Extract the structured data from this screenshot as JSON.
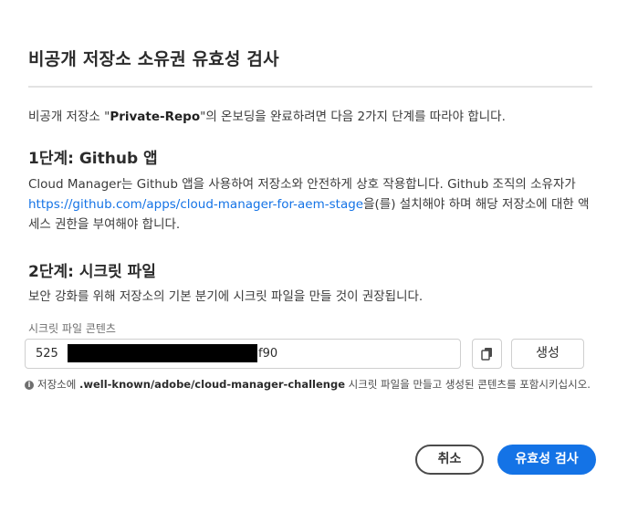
{
  "dialog": {
    "title": "비공개 저장소 소유권 유효성 검사",
    "intro_before": "비공개 저장소 \"",
    "intro_repo": "Private-Repo",
    "intro_after": "\"의 온보딩을 완료하려면 다음 2가지 단계를 따라야 합니다."
  },
  "step1": {
    "heading": "1단계: Github 앱",
    "text_before": "Cloud Manager는 Github 앱을 사용하여 저장소와 안전하게 상호 작용합니다. Github 조직의 소유자가 ",
    "link": "https://github.com/apps/cloud-manager-for-aem-stage",
    "text_after": "을(를) 설치해야 하며 해당 저장소에 대한 액세스 권한을 부여해야 합니다."
  },
  "step2": {
    "heading": "2단계: 시크릿 파일",
    "text": "보안 강화를 위해 저장소의 기본 분기에 시크릿 파일을 만들 것이 권장됩니다.",
    "field_label": "시크릿 파일 콘텐츠",
    "secret_prefix": "525",
    "secret_suffix": "f90",
    "generate_label": "생성",
    "hint_before": "저장소에 ",
    "hint_path": ".well-known/adobe/cloud-manager-challenge",
    "hint_after": " 시크릿 파일을 만들고 생성된 콘텐츠를 포함시키십시오.",
    "info_glyph": "i",
    "copy_icon": "copy-icon"
  },
  "footer": {
    "cancel_label": "취소",
    "validate_label": "유효성 검사"
  },
  "colors": {
    "accent": "#1473e6",
    "text": "#2c2c2c"
  }
}
